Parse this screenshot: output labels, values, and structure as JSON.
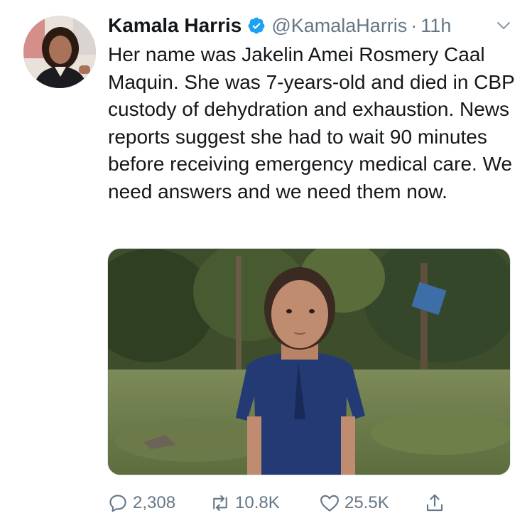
{
  "tweet": {
    "author": {
      "display_name": "Kamala Harris",
      "handle": "@KamalaHarris",
      "verified": true,
      "avatar_icon": "profile-photo"
    },
    "separator": "·",
    "timestamp": "11h",
    "text": "Her name was Jakelin Amei Rosmery Caal Maquin. She was 7-years-old and died in CBP custody of dehydration and exhaustion. News reports suggest she had to wait 90 minutes before receiving emergency medical care. We need answers and we need them now.",
    "media_icon": "photo-of-girl-outdoors",
    "actions": {
      "reply": {
        "icon": "reply-icon",
        "count": "2,308"
      },
      "retweet": {
        "icon": "retweet-icon",
        "count": "10.8K"
      },
      "like": {
        "icon": "heart-icon",
        "count": "25.5K"
      },
      "share": {
        "icon": "share-icon"
      }
    },
    "colors": {
      "text": "#14171a",
      "secondary": "#657786",
      "verified_blue": "#1da1f2"
    }
  }
}
